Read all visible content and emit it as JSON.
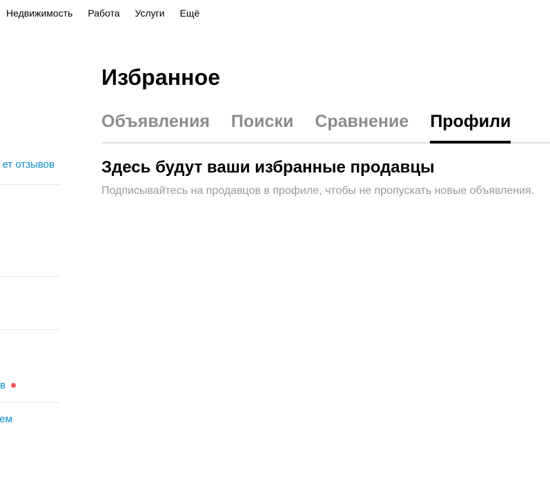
{
  "top_nav": {
    "items": [
      {
        "label": "Недвижимость"
      },
      {
        "label": "Работа"
      },
      {
        "label": "Услуги"
      },
      {
        "label": "Ещё"
      }
    ]
  },
  "sidebar": {
    "links": [
      {
        "label": "ет отзывов"
      },
      {
        "label": "в"
      },
      {
        "label": "ем"
      }
    ],
    "accent_color": "#0a8ccf",
    "notification_dot_color": "#f15a5a"
  },
  "main": {
    "title": "Избранное",
    "tabs": [
      {
        "label": "Объявления",
        "active": false
      },
      {
        "label": "Поиски",
        "active": false
      },
      {
        "label": "Сравнение",
        "active": false
      },
      {
        "label": "Профили",
        "active": true
      }
    ],
    "empty_state": {
      "title": "Здесь будут ваши избранные продавцы",
      "text": "Подписывайтесь на продавцов в профиле, чтобы не пропускать новые объявления."
    }
  }
}
